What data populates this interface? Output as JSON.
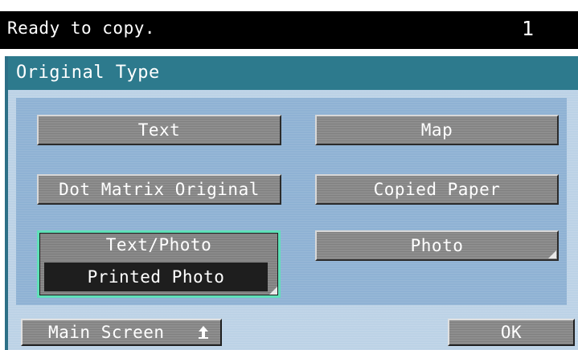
{
  "status": {
    "message": "Ready to copy.",
    "copies": "1"
  },
  "panel": {
    "title": "Original Type"
  },
  "options": {
    "text": "Text",
    "map": "Map",
    "dot_matrix": "Dot Matrix Original",
    "copied_paper": "Copied Paper",
    "text_photo": "Text/Photo",
    "text_photo_sub": "Printed Photo",
    "photo": "Photo"
  },
  "footer": {
    "main_screen": "Main Screen",
    "ok": "OK"
  },
  "icons": {
    "main_screen_icon": "up-arrow-icon",
    "corner_icon": "submenu-corner-icon"
  },
  "colors": {
    "header": "#2d7a8d",
    "selected_border": "#5fe0b8",
    "button": "#8e8e8e"
  }
}
